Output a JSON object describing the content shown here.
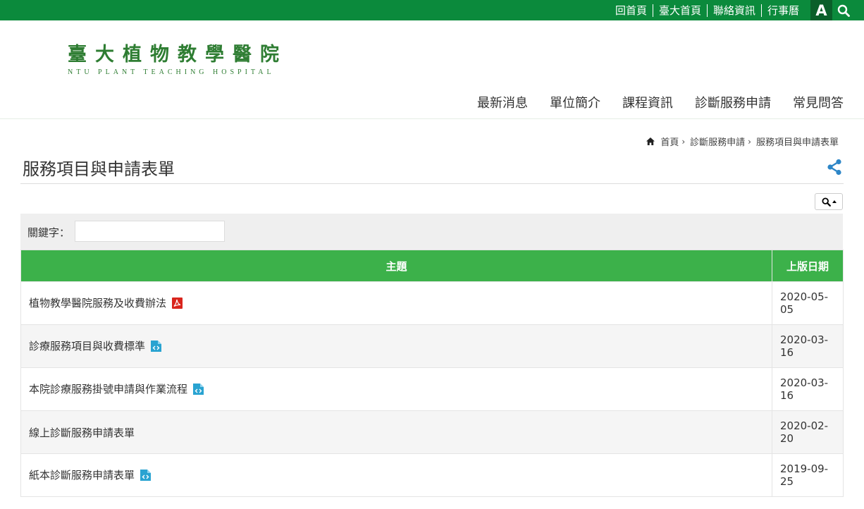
{
  "top_links": [
    "回首頁",
    "臺大首頁",
    "聯絡資訊",
    "行事曆"
  ],
  "font_button": "A",
  "logo": {
    "cn": "臺大植物教學醫院",
    "en": "NTU PLANT TEACHING HOSPITAL"
  },
  "nav": [
    "最新消息",
    "單位簡介",
    "課程資訊",
    "診斷服務申請",
    "常見問答"
  ],
  "breadcrumb": [
    "首頁",
    "診斷服務申請",
    "服務項目與申請表單"
  ],
  "breadcrumb_sep": "›",
  "page_title": "服務項目與申請表單",
  "filter": {
    "label": "關鍵字：",
    "value": ""
  },
  "table": {
    "headers": {
      "topic": "主題",
      "date": "上版日期"
    },
    "rows": [
      {
        "topic": "植物教學醫院服務及收費辦法",
        "date": "2020-05-05",
        "icon": "pdf-file-icon"
      },
      {
        "topic": "診療服務項目與收費標準",
        "date": "2020-03-16",
        "icon": "html-file-icon"
      },
      {
        "topic": "本院診療服務掛號申請與作業流程",
        "date": "2020-03-16",
        "icon": "html-file-icon"
      },
      {
        "topic": "線上診斷服務申請表單",
        "date": "2020-02-20",
        "icon": ""
      },
      {
        "topic": "紙本診斷服務申請表單",
        "date": "2019-09-25",
        "icon": "html-file-icon"
      }
    ]
  },
  "colors": {
    "topbar": "#0b8a3c",
    "header_green": "#3cb14a",
    "logo_green": "#2e7d32",
    "pdf_red": "#d9251d",
    "html_blue": "#29a3d1"
  }
}
